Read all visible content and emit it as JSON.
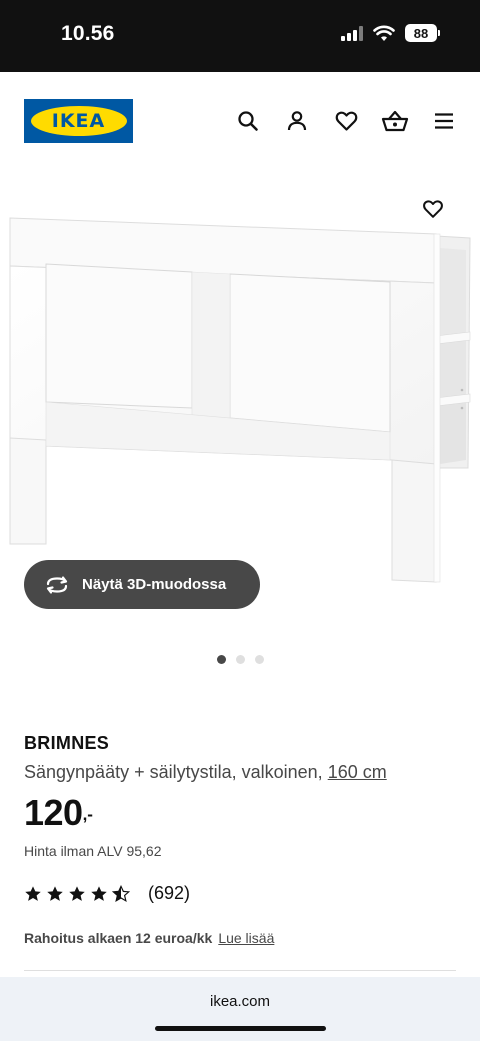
{
  "status_bar": {
    "time": "10.56",
    "battery": "88"
  },
  "header": {
    "logo_text": "IKEA",
    "icons": [
      "search-icon",
      "profile-icon",
      "favourites-icon",
      "cart-icon",
      "menu-icon"
    ]
  },
  "gallery": {
    "view_3d_label": "Näytä 3D-muodossa",
    "page_count": 3,
    "active_page": 1
  },
  "product": {
    "name": "BRIMNES",
    "description": "Sängynpääty + säilytystila, valkoinen,",
    "size_link": "160 cm",
    "price_integer": "120",
    "price_decimal": ",-",
    "vat_text": "Hinta ilman ALV 95,62",
    "rating_stars": 4.5,
    "rating_count": "(692)",
    "financing_text": "Rahoitus alkaen 12 euroa/kk",
    "financing_link": "Lue lisää"
  },
  "browser": {
    "url": "ikea.com"
  },
  "colors": {
    "brand_blue": "#0058a3",
    "brand_yellow": "#ffdb00",
    "dark_pill": "#484848"
  }
}
